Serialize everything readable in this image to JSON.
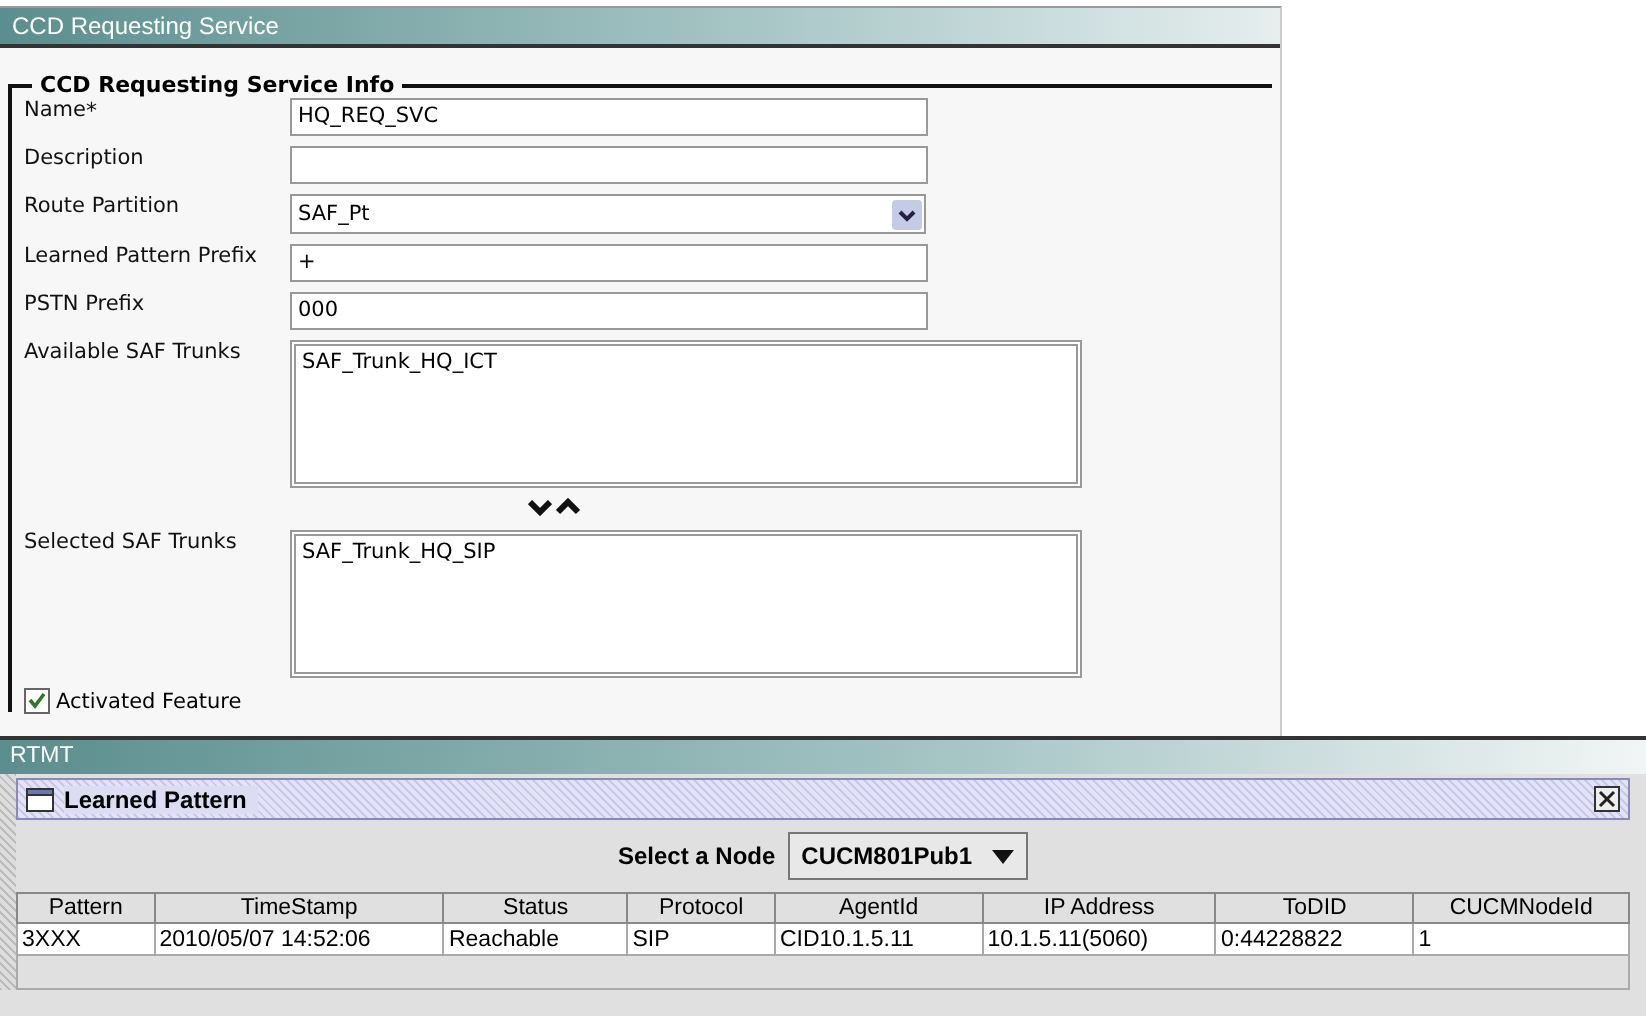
{
  "page": {
    "title": "CCD Requesting Service"
  },
  "section": {
    "title": "CCD Requesting Service Info",
    "fields": [
      {
        "kind": "text",
        "label": "Name",
        "required_mark": "*",
        "value": "HQ_REQ_SVC"
      },
      {
        "kind": "text",
        "label": "Description"
      },
      {
        "kind": "select",
        "label": "Route Partition",
        "value": "SAF_Pt"
      },
      {
        "kind": "text",
        "label": "Learned Pattern Prefix",
        "value": "+"
      },
      {
        "kind": "text",
        "label": "PSTN Prefix",
        "value": "000"
      },
      {
        "kind": "list",
        "label": "Available SAF Trunks",
        "items": [
          "SAF_Trunk_HQ_ICT"
        ]
      },
      {
        "kind": "movers"
      },
      {
        "kind": "list",
        "label": "Selected SAF Trunks",
        "items": [
          "SAF_Trunk_HQ_SIP"
        ]
      }
    ],
    "checkbox": {
      "label": "Activated Feature",
      "checked": true
    }
  },
  "rtmt": {
    "title": "RTMT",
    "window_title": "Learned Pattern",
    "node_label": "Select a Node",
    "node_value": "CUCM801Pub1",
    "table": {
      "columns": [
        "Pattern",
        "TimeStamp",
        "Status",
        "Protocol",
        "AgentId",
        "IP Address",
        "ToDID",
        "CUCMNodeId"
      ],
      "rows": [
        [
          "3XXX",
          "2010/05/07 14:52:06",
          "Reachable",
          "SIP",
          "CID10.1.5.11",
          "10.1.5.11(5060)",
          "0:44228822",
          "1"
        ]
      ]
    }
  }
}
